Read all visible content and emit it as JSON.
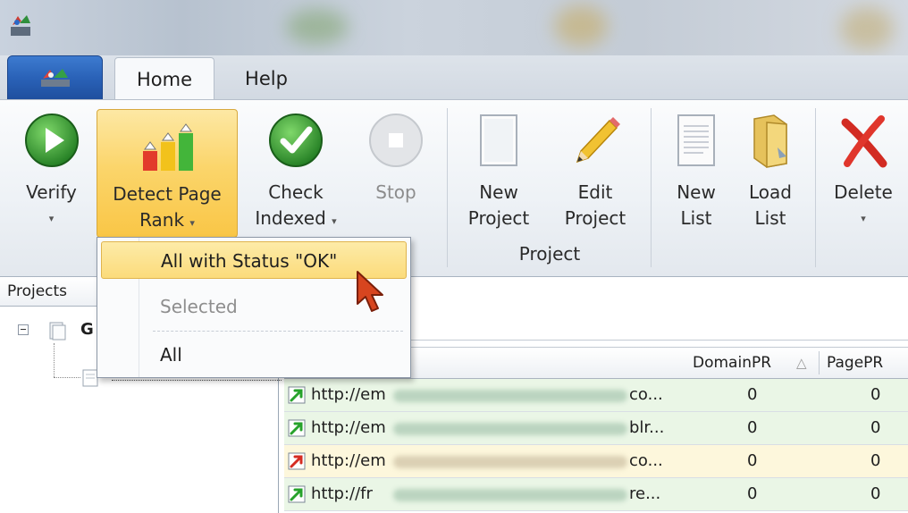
{
  "tabs": {
    "home": "Home",
    "help": "Help"
  },
  "ribbon": {
    "verify": {
      "line1": "Verify",
      "arrow": "▾"
    },
    "detect_page_rank": {
      "line1": "Detect Page",
      "line2": "Rank",
      "arrow": "▾"
    },
    "check_indexed": {
      "line1": "Check",
      "line2": "Indexed",
      "arrow": "▾"
    },
    "stop": {
      "line1": "Stop"
    },
    "new_project": {
      "line1": "New",
      "line2": "Project"
    },
    "edit_project": {
      "line1": "Edit",
      "line2": "Project"
    },
    "project_group_label": "Project",
    "new_list": {
      "line1": "New",
      "line2": "List"
    },
    "load_list": {
      "line1": "Load",
      "line2": "List"
    },
    "delete": {
      "line1": "Delete",
      "arrow": "▾"
    }
  },
  "dropdown": {
    "items": [
      {
        "label": "All with Status \"OK\"",
        "state": "highlighted"
      },
      {
        "label": "Selected",
        "state": "disabled"
      },
      {
        "label": "All",
        "state": "normal"
      }
    ]
  },
  "projects_panel": {
    "header": "Projects",
    "root_label": "G"
  },
  "grid": {
    "columns": {
      "domain_pr": "DomainPR",
      "sort_icon": "sort-ascending-icon",
      "page_pr": "PagePR"
    },
    "rows": [
      {
        "url_start": "http://em",
        "url_end": "co...",
        "domain_pr": "0",
        "page_pr": "0",
        "status": "up",
        "bg": "#eaf6e6"
      },
      {
        "url_start": "http://em",
        "url_end": "blr...",
        "domain_pr": "0",
        "page_pr": "0",
        "status": "up",
        "bg": "#eaf6e6"
      },
      {
        "url_start": "http://em",
        "url_end": "co...",
        "domain_pr": "0",
        "page_pr": "0",
        "status": "down",
        "bg": "#fdf7dc"
      },
      {
        "url_start": "http://fr",
        "url_end": "re...",
        "domain_pr": "0",
        "page_pr": "0",
        "status": "up",
        "bg": "#eaf6e6"
      }
    ]
  }
}
